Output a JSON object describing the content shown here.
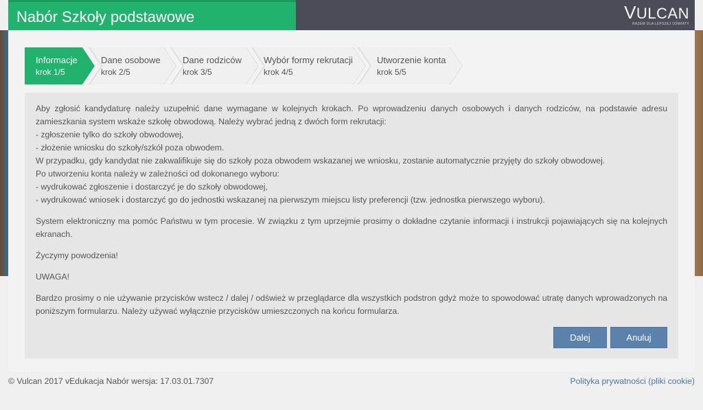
{
  "header": {
    "title": "Nabór Szkoły podstawowe",
    "logo_main": "ULCAN",
    "logo_first": "V",
    "logo_sub": "RAZEM DLA LEPSZEJ OŚWIATY"
  },
  "steps": [
    {
      "title": "Informacje",
      "sub": "krok 1/5",
      "active": true
    },
    {
      "title": "Dane osobowe",
      "sub": "krok 2/5",
      "active": false
    },
    {
      "title": "Dane rodziców",
      "sub": "krok 3/5",
      "active": false
    },
    {
      "title": "Wybór formy rekrutacji",
      "sub": "krok 4/5",
      "active": false
    },
    {
      "title": "Utworzenie konta",
      "sub": "krok 5/5",
      "active": false
    }
  ],
  "content": {
    "p1_lines": [
      "Aby zgłosić kandydaturę należy uzupełnić dane wymagane w kolejnych krokach. Po wprowadzeniu danych osobowych i danych rodziców, na podstawie adresu zamieszkania system wskaże szkołę obwodową. Należy wybrać jedną z dwóch form rekrutacji:",
      "- zgłoszenie tylko do szkoły obwodowej,",
      "- złożenie wniosku do szkoły/szkół poza obwodem.",
      "W przypadku, gdy kandydat nie zakwalifikuje się do szkoły poza obwodem wskazanej we wniosku, zostanie automatycznie przyjęty do szkoły obwodowej.",
      "Po utworzeniu konta należy w zależności od dokonanego wyboru:",
      "- wydrukować zgłoszenie i dostarczyć je do szkoły obwodowej,",
      "- wydrukować wniosek i dostarczyć go do jednostki wskazanej na pierwszym miejscu listy preferencji (tzw. jednostka pierwszego wyboru)."
    ],
    "p2": "System elektroniczny ma pomóc Państwu w tym procesie. W związku z tym uprzejmie prosimy o dokładne czytanie informacji i instrukcji pojawiających się na kolejnych ekranach.",
    "p3": "Życzymy powodzenia!",
    "p4": "UWAGA!",
    "p5": "Bardzo prosimy o nie używanie przycisków wstecz / dalej / odśwież w przeglądarce dla wszystkich podstron gdyż może to spowodować utratę danych wprowadzonych na poniższym formularzu. Należy używać wyłącznie przycisków umieszczonych na końcu formularza."
  },
  "buttons": {
    "next": "Dalej",
    "cancel": "Anuluj"
  },
  "footer": {
    "copyright": "© Vulcan 2017 vEdukacja Nabór wersja: 17.03.01.7307",
    "privacy": "Polityka prywatności (pliki cookie)"
  },
  "colors": {
    "accent_green": "#21b36d",
    "header_dark": "#4b4c58",
    "button_blue": "#5b82ab",
    "link_blue": "#4c76a6"
  }
}
